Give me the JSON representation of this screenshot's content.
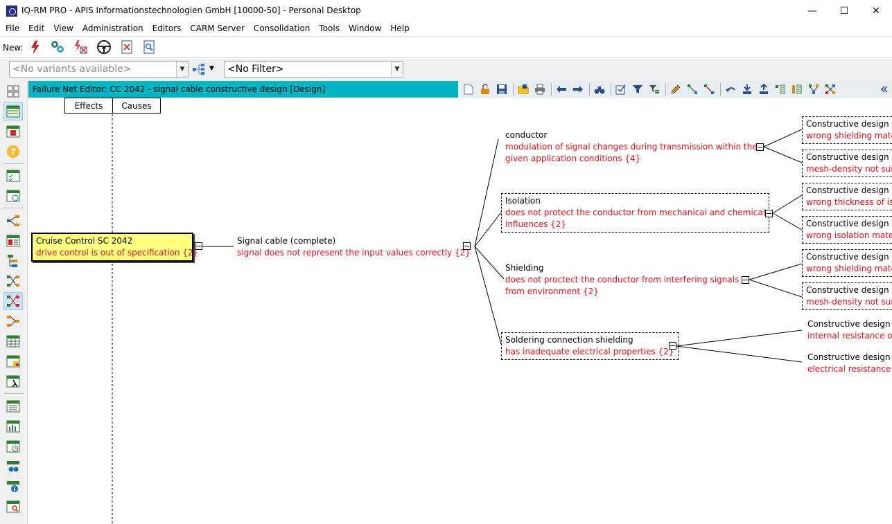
{
  "window": {
    "title": "IQ-RM PRO - APIS Informationstechnologien GmbH [10000-50] - Personal Desktop",
    "minimize": "—",
    "maximize": "☐",
    "close": "✕"
  },
  "menu": [
    {
      "label": "File"
    },
    {
      "label": "Edit"
    },
    {
      "label": "View"
    },
    {
      "label": "Administration"
    },
    {
      "label": "Editors"
    },
    {
      "label": "CARM Server"
    },
    {
      "label": "Consolidation"
    },
    {
      "label": "Tools"
    },
    {
      "label": "Window"
    },
    {
      "label": "Help"
    }
  ],
  "newbar": {
    "label": "New:",
    "icons": [
      "new-failure-icon",
      "new-function-icon",
      "new-failure-filter-icon",
      "new-steering-wheel-icon",
      "new-document-icon",
      "new-search-document-icon"
    ]
  },
  "filters": {
    "variants": "<No variants available>",
    "filter": "<No Filter>"
  },
  "editor": {
    "title": "Failure Net Editor: CC 2042 - signal cable constructive design [Design]",
    "tabs": {
      "effects": "Effects",
      "causes": "Causes"
    }
  },
  "nodes": {
    "root": {
      "name": "Cruise Control SC 2042",
      "failure": "drive control is out of specification {2}"
    },
    "focus": {
      "name": "Signal cable (complete)",
      "failure": "signal does not represent the input values correctly {2}"
    },
    "conductor": {
      "name": "conductor",
      "failure1": "modulation of signal changes during transmission within the",
      "failure2": "given application conditions {4}"
    },
    "isolation": {
      "name": "Isolation",
      "failure1": "does not protect the conductor from mechanical and chemical",
      "failure2": "influences {2}"
    },
    "shielding": {
      "name": "Shielding",
      "failure1": "does not proctect the conductor from interfering signals",
      "failure2": "from environment {2}"
    },
    "soldering": {
      "name": "Soldering connection shielding",
      "failure": "has inadequate electrical properties {2}"
    },
    "causes": [
      {
        "name": "Constructive design s",
        "failure": "wrong shielding mate"
      },
      {
        "name": "Constructive design s",
        "failure": "mesh-density not sui"
      },
      {
        "name": "Constructive design o",
        "failure": "wrong thickness of is"
      },
      {
        "name": "Constructive design o",
        "failure": "wrong isolation mate"
      },
      {
        "name": "Constructive design s",
        "failure": "wrong shielding mate"
      },
      {
        "name": "Constructive design s",
        "failure": "mesh-density not sui"
      },
      {
        "name": "Constructive design s",
        "failure": "internal resistance of"
      },
      {
        "name": "Constructive design s",
        "failure": "electrical resistance o"
      }
    ]
  }
}
